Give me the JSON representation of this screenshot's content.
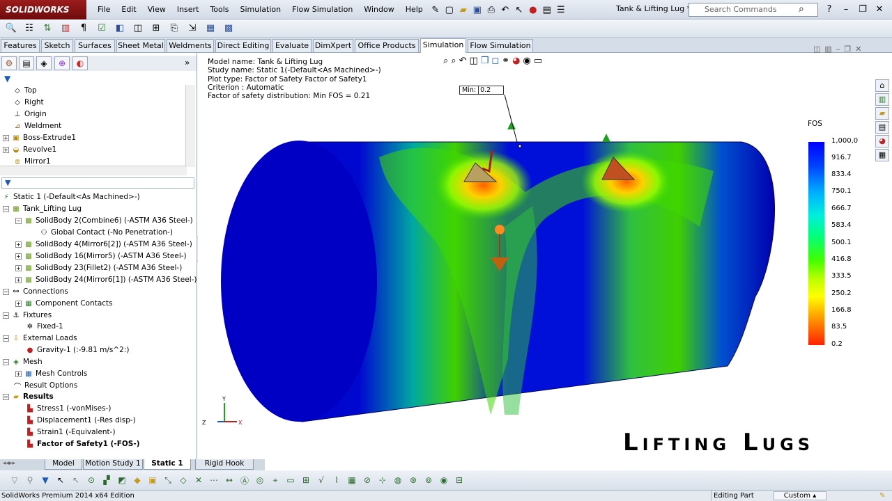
{
  "app": {
    "logo": "SOLIDWORKS",
    "document_title": "Tank & Lifting Lug *"
  },
  "menu": [
    "File",
    "Edit",
    "View",
    "Insert",
    "Tools",
    "Simulation",
    "Flow Simulation",
    "Window",
    "Help"
  ],
  "search": {
    "placeholder": "Search Commands"
  },
  "ribbon_tabs": [
    {
      "label": "Features"
    },
    {
      "label": "Sketch"
    },
    {
      "label": "Surfaces"
    },
    {
      "label": "Sheet Metal"
    },
    {
      "label": "Weldments"
    },
    {
      "label": "Direct Editing"
    },
    {
      "label": "Evaluate"
    },
    {
      "label": "DimXpert"
    },
    {
      "label": "Office Products"
    },
    {
      "label": "Simulation",
      "active": true
    },
    {
      "label": "Flow Simulation"
    }
  ],
  "feature_tree": [
    "Top",
    "Right",
    "Origin",
    "Weldment",
    "Boss-Extrude1",
    "Revolve1",
    "Mirror1"
  ],
  "study_tree": {
    "root": "Static 1 (-Default<As Machined>-)",
    "part": "Tank_Lifting Lug",
    "bodies": [
      "SolidBody 2(Combine6) (-ASTM A36 Steel-)",
      "Global Contact (-No Penetration-)",
      "SolidBody 4(Mirror6[2]) (-ASTM A36 Steel-)",
      "SolidBody 16(Mirror5) (-ASTM A36 Steel-)",
      "SolidBody 23(Fillet2) (-ASTM A36 Steel-)",
      "SolidBody 24(Mirror6[1]) (-ASTM A36 Steel-)"
    ],
    "connections": "Connections",
    "component_contacts": "Component Contacts",
    "fixtures": "Fixtures",
    "fixed": "Fixed-1",
    "external_loads": "External Loads",
    "gravity": "Gravity-1 (:-9.81 m/s^2:)",
    "mesh": "Mesh",
    "mesh_controls": "Mesh Controls",
    "result_options": "Result Options",
    "results": "Results",
    "results_items": [
      "Stress1 (-vonMises-)",
      "Displacement1 (-Res disp-)",
      "Strain1 (-Equivalent-)",
      "Factor of Safety1 (-FOS-)"
    ]
  },
  "plot_info": {
    "model": "Model name: Tank & Lifting Lug",
    "study": "Study name: Static 1(-Default<As Machined>-)",
    "plot_type": "Plot type: Factor of Safety Factor of Safety1",
    "criterion": "Criterion : Automatic",
    "distribution": "Factor of safety distribution: Min FOS = 0.21"
  },
  "min_label": {
    "prefix": "Min:",
    "value": "0.2"
  },
  "legend": {
    "title": "FOS",
    "labels": [
      "1,000,0",
      "916.7",
      "833.4",
      "750.1",
      "666.7",
      "583.4",
      "500.1",
      "416.8",
      "333.5",
      "250.2",
      "166.8",
      "83.5",
      "0.2"
    ]
  },
  "overlay_title": "Lifting Lugs",
  "bottom_tabs": [
    {
      "label": "Model"
    },
    {
      "label": "Motion Study 1"
    },
    {
      "label": "Static 1",
      "active": true
    },
    {
      "label": "Rigid Hook"
    }
  ],
  "status": {
    "edition": "SolidWorks Premium 2014 x64 Edition",
    "mode": "Editing Part",
    "units": "Custom"
  },
  "colors": {
    "accent": "#0000ff",
    "brand": "#8b1414"
  }
}
